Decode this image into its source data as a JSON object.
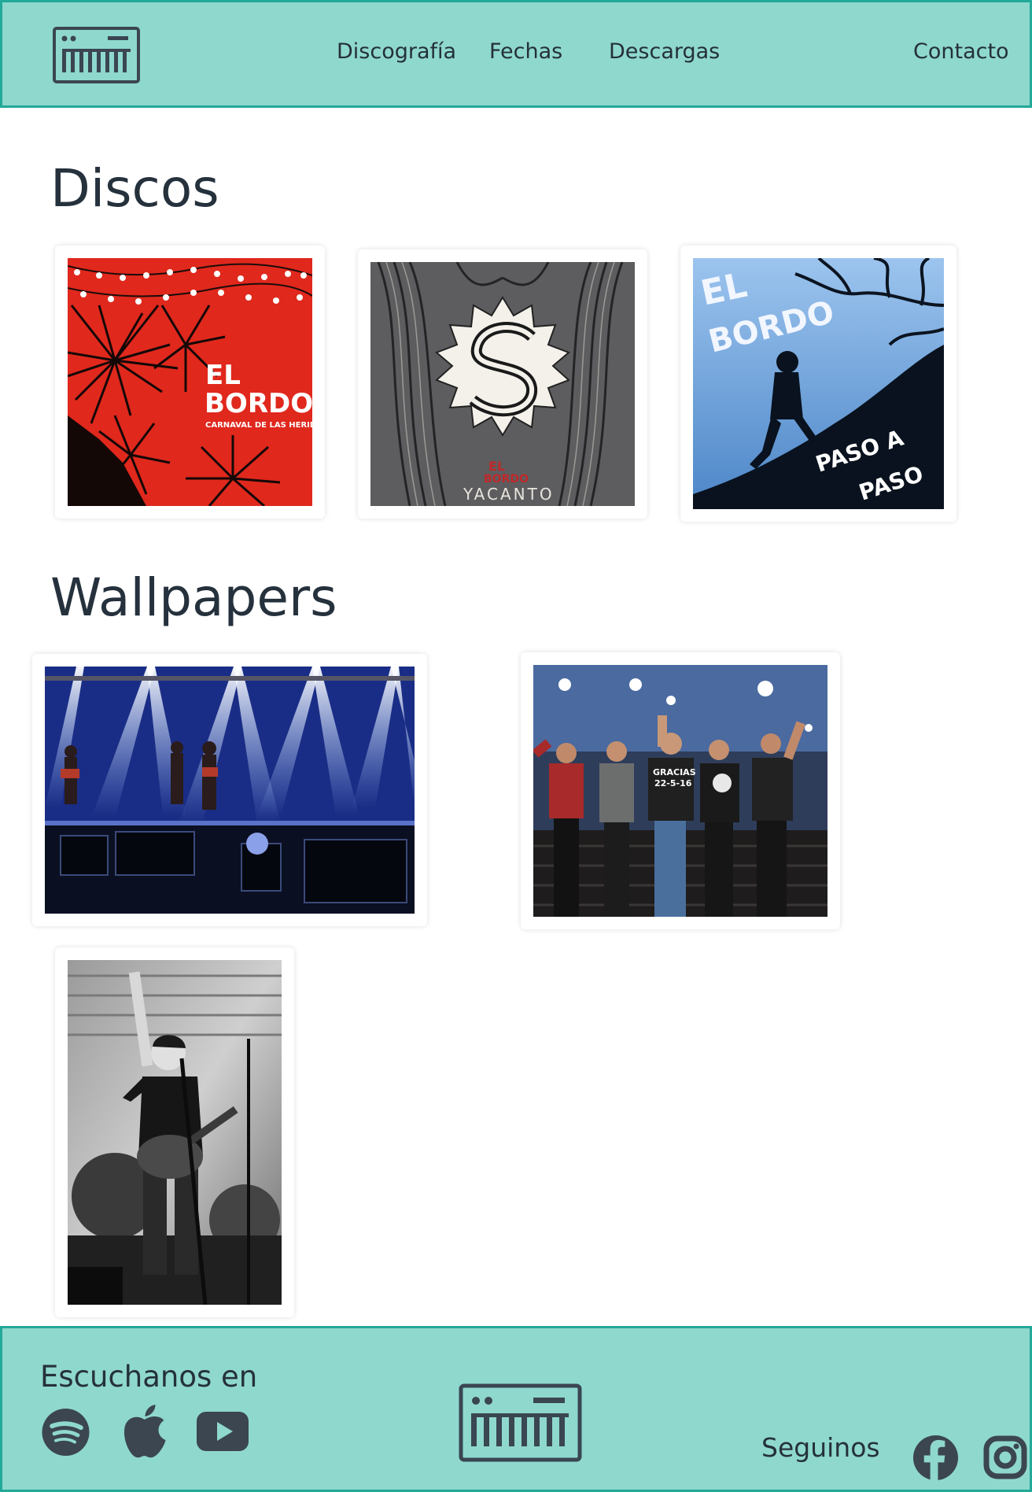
{
  "header": {
    "logo_icon": "keyboard-icon",
    "nav": {
      "discografia": "Discografía",
      "fechas": "Fechas",
      "descargas": "Descargas",
      "contacto": "Contacto"
    }
  },
  "discos": {
    "title": "Discos",
    "albums": [
      {
        "cover_text_line1": "EL",
        "cover_text_line2": "BORDO",
        "cover_text_line3": "CARNAVAL DE LAS HERIDAS"
      },
      {
        "cover_text_line1": "EL",
        "cover_text_line2": "BORDO",
        "cover_text_line3": "YACANTO"
      },
      {
        "cover_text_line1": "EL",
        "cover_text_line2": "BORDO",
        "cover_text_line3": "PASO A",
        "cover_text_line4": "PASO"
      }
    ]
  },
  "wallpapers": {
    "title": "Wallpapers",
    "shirt_text_line1": "GRACIAS",
    "shirt_text_line2": "22-5-16"
  },
  "footer": {
    "listen_label": "Escuchanos en",
    "follow_label": "Seguinos",
    "listen_icons": [
      "spotify-icon",
      "apple-icon",
      "youtube-icon"
    ],
    "follow_icons": [
      "facebook-icon",
      "instagram-icon"
    ]
  },
  "colors": {
    "header_bg": "#8fd8cd",
    "border": "#23a998",
    "text": "#25313c"
  }
}
